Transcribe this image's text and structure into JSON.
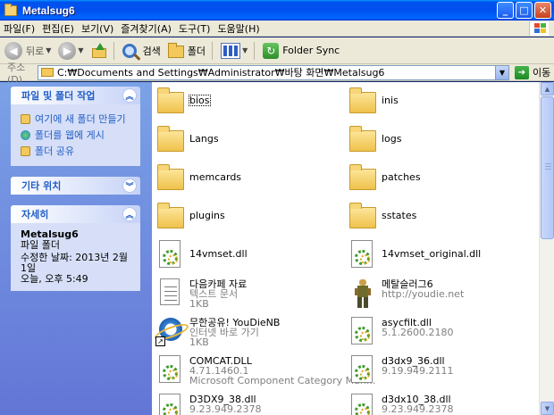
{
  "window": {
    "title": "Metalsug6",
    "minimize": "_",
    "maximize": "□",
    "close": "✕"
  },
  "menu": [
    "파일(F)",
    "편집(E)",
    "보기(V)",
    "즐겨찾기(A)",
    "도구(T)",
    "도움말(H)"
  ],
  "toolbar": {
    "back": "뒤로",
    "search": "검색",
    "folders": "폴더",
    "folder_sync": "Folder Sync"
  },
  "address": {
    "label": "주소(D)",
    "path": "C:₩Documents and Settings₩Administrator₩바탕 화면₩Metalsug6",
    "go": "이동"
  },
  "taskpane": {
    "tasks_title": "파일 및 폴더 작업",
    "tasks": [
      "여기에 새 폴더 만들기",
      "폴더를 웹에 게시",
      "폴더 공유"
    ],
    "other_title": "기타 위치",
    "details_title": "자세히",
    "details": {
      "name": "Metalsug6",
      "type": "파일 폴더",
      "modified_1": "수정한 날짜: 2013년 2월 1일",
      "modified_2": "오늘, 오후 5:49"
    }
  },
  "items": [
    {
      "name": "bios",
      "icon": "folder-icon"
    },
    {
      "name": "inis",
      "icon": "folder-icon"
    },
    {
      "name": "Langs",
      "icon": "folder-icon"
    },
    {
      "name": "logs",
      "icon": "folder-icon"
    },
    {
      "name": "memcards",
      "icon": "folder-icon"
    },
    {
      "name": "patches",
      "icon": "folder-icon"
    },
    {
      "name": "plugins",
      "icon": "folder-icon"
    },
    {
      "name": "sstates",
      "icon": "folder-icon"
    },
    {
      "name": "14vmset.dll",
      "icon": "dll-icon"
    },
    {
      "name": "14vmset_original.dll",
      "icon": "dll-icon"
    },
    {
      "name": "다음카페 자료",
      "l2": "텍스트 문서",
      "l3": "1KB",
      "icon": "text-file-icon"
    },
    {
      "name": "메탈슬러그6",
      "l2": "http://youdie.net",
      "icon": "game-icon"
    },
    {
      "name": "무한공유! YouDieNB",
      "l2": "인터넷 바로 가기",
      "l3": "1KB",
      "icon": "internet-shortcut-icon"
    },
    {
      "name": "asycfilt.dll",
      "l2": "5.1.2600.2180",
      "icon": "dll-icon"
    },
    {
      "name": "COMCAT.DLL",
      "l2": "4.71.1460.1",
      "l3": "Microsoft Component Category Man...",
      "icon": "dll-icon"
    },
    {
      "name": "d3dx9_36.dll",
      "l2": "9.19.949.2111",
      "icon": "dll-icon"
    },
    {
      "name": "D3DX9_38.dll",
      "l2": "9.23.949.2378",
      "icon": "dll-icon"
    },
    {
      "name": "d3dx10_38.dll",
      "l2": "9.23.949.2378",
      "icon": "dll-icon"
    }
  ]
}
